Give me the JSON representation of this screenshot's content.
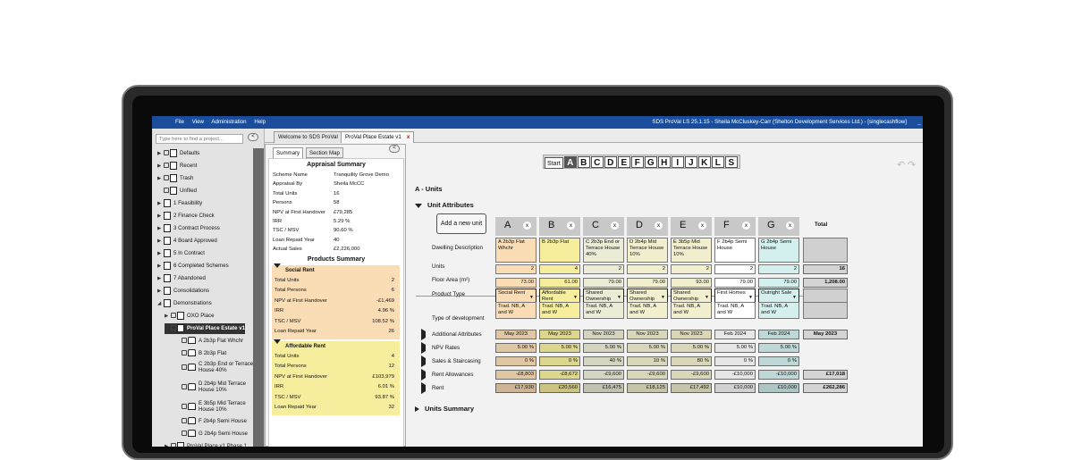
{
  "app": {
    "menu": [
      "File",
      "View",
      "Administration",
      "Help"
    ],
    "title": "SDS ProVal LS 25.1.15 - Sheila McCluskey-Carr (Shelton Development Services Ltd.) - [singlecashflow]",
    "window_buttons": [
      "_",
      "□",
      "x"
    ]
  },
  "sidebar": {
    "search_placeholder": "Type here to find a project...",
    "collapse_label": "<",
    "tree": [
      {
        "label": "Defaults"
      },
      {
        "label": "Recent"
      },
      {
        "label": "Trash"
      },
      {
        "label": "Unfiled"
      },
      {
        "label": "1 Feasibility"
      },
      {
        "label": "2 Finance Check"
      },
      {
        "label": "3 Contract Process"
      },
      {
        "label": "4 Board Approved"
      },
      {
        "label": "5 In Contract"
      },
      {
        "label": "6 Completed Schemes"
      },
      {
        "label": "7 Abandoned"
      },
      {
        "label": "Consolidations"
      },
      {
        "label": "Demonstrations"
      },
      {
        "label": "OXO Place"
      },
      {
        "label": "ProVal Place Estate v1"
      },
      {
        "label": "A 2b3p Flat Whchr"
      },
      {
        "label": "B 2b3p Flat"
      },
      {
        "label": "C 2b3p End or Terrace House 40%"
      },
      {
        "label": "D 2b4p Mid Terrace House 10%"
      },
      {
        "label": "E 3b5p Mid Terrace House 10%"
      },
      {
        "label": "F 2b4p Semi House"
      },
      {
        "label": "G 2b4p Semi House"
      },
      {
        "label": "ProVal Place v1 Phase 1"
      }
    ]
  },
  "tabs": [
    {
      "label": "Welcome to SDS ProVal"
    },
    {
      "label": "ProVal Place Estate v1",
      "close": "x"
    }
  ],
  "summary_panel": {
    "collapse_label": "<",
    "subtabs": [
      "Summary",
      "Section Map"
    ],
    "appraisal_title": "Appraisal Summary",
    "appraisal_rows": [
      {
        "label": "Scheme Name",
        "value": "Tranquility Grove Demo"
      },
      {
        "label": "Appraisal By",
        "value": "Sheila McCC"
      },
      {
        "label": "Total Units",
        "value": "16"
      },
      {
        "label": "Persons",
        "value": "58"
      },
      {
        "label": "NPV at First Handover",
        "value": "£79,285"
      },
      {
        "label": "IRR",
        "value": "5.29 %"
      },
      {
        "label": "TSC / MSV",
        "value": "90.60 %"
      },
      {
        "label": "Loan Repaid Year",
        "value": "40"
      },
      {
        "label": "Actual Sales",
        "value": "£2,226,000"
      }
    ],
    "products_title": "Products Summary",
    "social_rent": {
      "title": "Social Rent",
      "rows": [
        {
          "label": "Total Units",
          "value": "2"
        },
        {
          "label": "Total Persons",
          "value": "6"
        },
        {
          "label": "NPV at First Handover",
          "value": "-£1,469"
        },
        {
          "label": "IRR",
          "value": "4.96 %"
        },
        {
          "label": "TSC / MSV",
          "value": "108.52 %"
        },
        {
          "label": "Loan Repaid Year",
          "value": "26"
        }
      ]
    },
    "affordable_rent": {
      "title": "Affordable Rent",
      "rows": [
        {
          "label": "Total Units",
          "value": "4"
        },
        {
          "label": "Total Persons",
          "value": "12"
        },
        {
          "label": "NPV at First Handover",
          "value": "£103,979"
        },
        {
          "label": "IRR",
          "value": "6.01 %"
        },
        {
          "label": "TSC / MSV",
          "value": "93.87 %"
        },
        {
          "label": "Loan Repaid Year",
          "value": "32"
        }
      ]
    }
  },
  "units": {
    "nav": [
      "Start",
      "A",
      "B",
      "C",
      "D",
      "E",
      "F",
      "G",
      "H",
      "I",
      "J",
      "K",
      "L",
      "S"
    ],
    "nav_current": "A",
    "undo_icons": [
      "↶",
      "↷"
    ],
    "section_title": "A - Units",
    "attributes_title": "Unit Attributes",
    "add_button": "Add a new unit",
    "total_label": "Total",
    "row_labels": {
      "description": "Dwelling Description",
      "units": "Units",
      "floor_area": "Floor Area (m²)",
      "product_type": "Product Type",
      "dev_type": "Type of development",
      "additional": "Additional Attributes",
      "npv_rates": "NPV Rates",
      "sales": "Sales & Staircasing",
      "rent_allow": "Rent Allowances",
      "rent": "Rent"
    },
    "units_summary": "Units Summary",
    "colors": {
      "A": "#fadcb5",
      "B": "#f6ee9d",
      "C": "#ecebd6",
      "D": "#f1efce",
      "E": "#f2efce",
      "F": "#ffffff",
      "G": "#d3f0ef"
    },
    "columns": [
      {
        "letter": "A",
        "close": "x",
        "desc": "A 2b3p Flat Whchr",
        "units": "2",
        "area": "73.00",
        "product": "Social Rent",
        "dev": "Trad. NB, A and W",
        "additional": "May 2023",
        "npv": "5.00 %",
        "sales": "0 %",
        "rent_allow": "-£8,803",
        "rent": "£17,930"
      },
      {
        "letter": "B",
        "close": "x",
        "desc": "B 2b3p Flat",
        "units": "4",
        "area": "61.00",
        "product": "Affordable Rent",
        "dev": "Trad. NB, A and W",
        "additional": "May 2023",
        "npv": "5.00 %",
        "sales": "0 %",
        "rent_allow": "-£8,672",
        "rent": "£20,560"
      },
      {
        "letter": "C",
        "close": "x",
        "desc": "C 2b3p End or Terrace House 40%",
        "units": "2",
        "area": "79.00",
        "product": "Shared Ownership",
        "dev": "Trad. NB, A and W",
        "additional": "Nov 2023",
        "npv": "5.00 %",
        "sales": "40 %",
        "rent_allow": "-£9,600",
        "rent": "£16,475"
      },
      {
        "letter": "D",
        "close": "x",
        "desc": "D 2b4p Mid Terrace House 10%",
        "units": "2",
        "area": "79.00",
        "product": "Shared Ownership",
        "dev": "Trad. NB, A and W",
        "additional": "Nov 2023",
        "npv": "5.00 %",
        "sales": "10 %",
        "rent_allow": "-£9,600",
        "rent": "£18,125"
      },
      {
        "letter": "E",
        "close": "x",
        "desc": "E 3b5p Mid Terrace House 10%",
        "units": "2",
        "area": "93.00",
        "product": "Shared Ownership",
        "dev": "Trad. NB, A and W",
        "additional": "Nov 2023",
        "npv": "5.00 %",
        "sales": "80 %",
        "rent_allow": "-£9,600",
        "rent": "£17,492"
      },
      {
        "letter": "F",
        "close": "x",
        "desc": "F 2b4p Semi House",
        "units": "2",
        "area": "79.00",
        "product": "First Homes",
        "dev": "Trad. NB, A and W",
        "additional": "Feb 2024",
        "npv": "5.00 %",
        "sales": "0 %",
        "rent_allow": "-£10,000",
        "rent": "£10,000"
      },
      {
        "letter": "G",
        "close": "x",
        "desc": "G 2b4p Semi House",
        "units": "2",
        "area": "79.00",
        "product": "Outright Sale",
        "dev": "Trad. NB, A and W",
        "additional": "Feb 2024",
        "npv": "5.00 %",
        "sales": "0 %",
        "rent_allow": "-£10,000",
        "rent": "£10,000"
      }
    ],
    "totals": {
      "units": "16",
      "area": "1,208.00",
      "additional": "May 2023",
      "rent_allow": "£17,018",
      "rent": "£262,286"
    }
  }
}
